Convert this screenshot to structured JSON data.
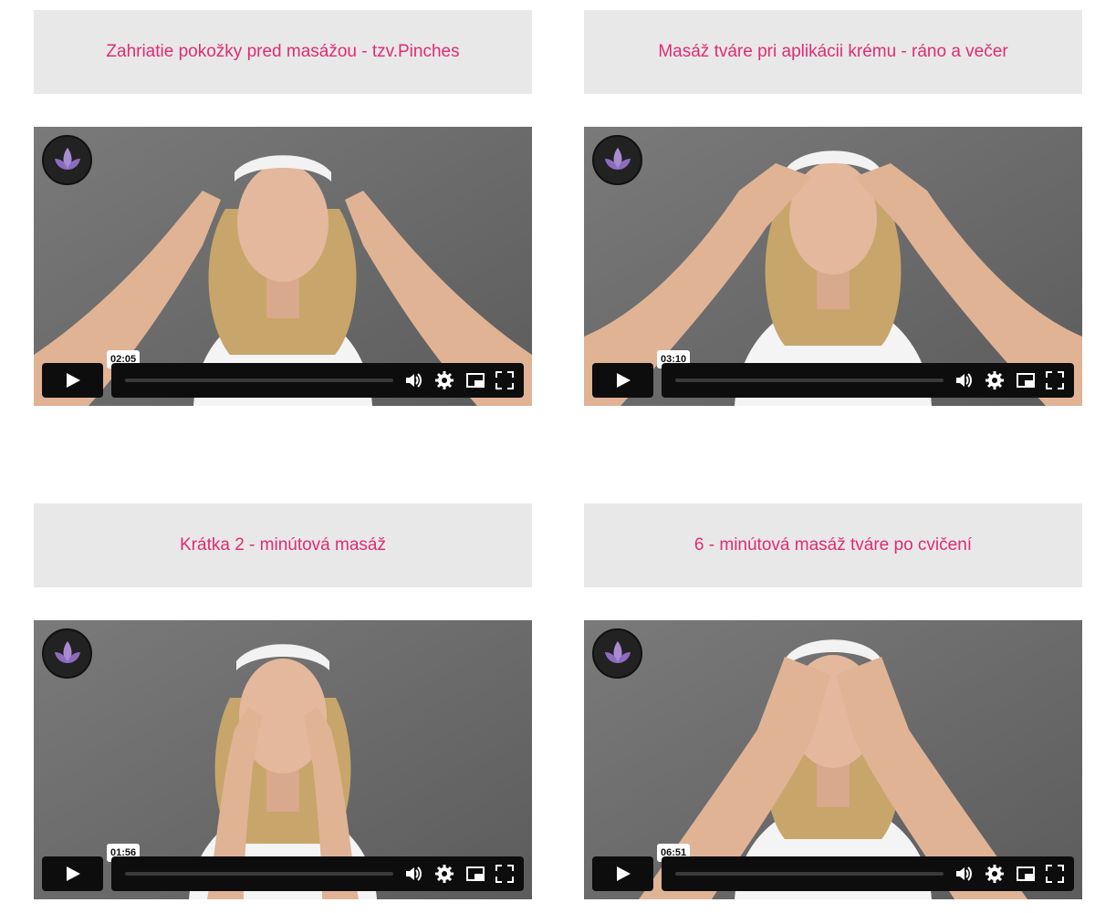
{
  "videos": [
    {
      "title": "Zahriatie pokožky pred masážou - tzv.Pinches",
      "duration": "02:05",
      "logo_icon": "lotus-icon"
    },
    {
      "title": "Masáž tváre pri aplikácii krému - ráno a večer",
      "duration": "03:10",
      "logo_icon": "lotus-icon"
    },
    {
      "title": "Krátka 2 - minútová masáž",
      "duration": "01:56",
      "logo_icon": "lotus-icon"
    },
    {
      "title": "6 - minútová masáž tváre po cvičení",
      "duration": "06:51",
      "logo_icon": "lotus-icon"
    }
  ],
  "colors": {
    "title": "#e02b75",
    "title_bg": "#e8e8e8",
    "controls_bg": "#0d0d0d"
  }
}
